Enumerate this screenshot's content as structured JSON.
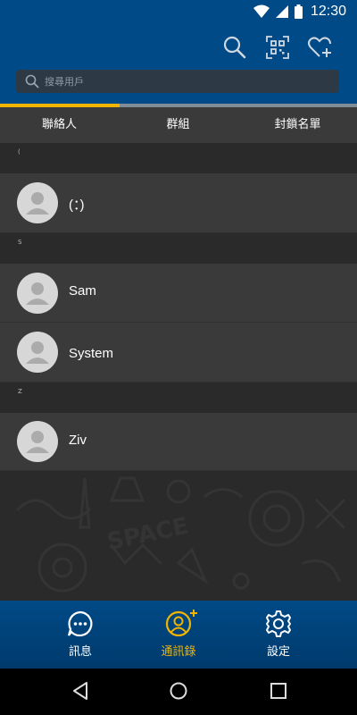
{
  "status_bar": {
    "time": "12:30"
  },
  "header": {
    "search_placeholder": "搜尋用戶",
    "icons": [
      "search-icon",
      "qr-code-icon",
      "add-favorite-icon"
    ]
  },
  "tabs": [
    {
      "label": "聯絡人",
      "active": true
    },
    {
      "label": "群組",
      "active": false
    },
    {
      "label": "封鎖名單",
      "active": false
    }
  ],
  "sections": [
    {
      "letter": "(",
      "contacts": [
        {
          "name": "(：)"
        }
      ]
    },
    {
      "letter": "S",
      "contacts": [
        {
          "name": "Sam"
        },
        {
          "name": "System"
        }
      ]
    },
    {
      "letter": "Z",
      "contacts": [
        {
          "name": "Ziv"
        }
      ]
    }
  ],
  "bottom_nav": [
    {
      "label": "訊息",
      "icon": "chat-bubble-icon",
      "active": false
    },
    {
      "label": "通訊錄",
      "icon": "contacts-icon",
      "active": true
    },
    {
      "label": "設定",
      "icon": "gear-icon",
      "active": false
    }
  ],
  "colors": {
    "primary": "#004a87",
    "accent": "#f0b400",
    "row_bg": "#3a3a3a",
    "background": "#2a2a2a"
  }
}
